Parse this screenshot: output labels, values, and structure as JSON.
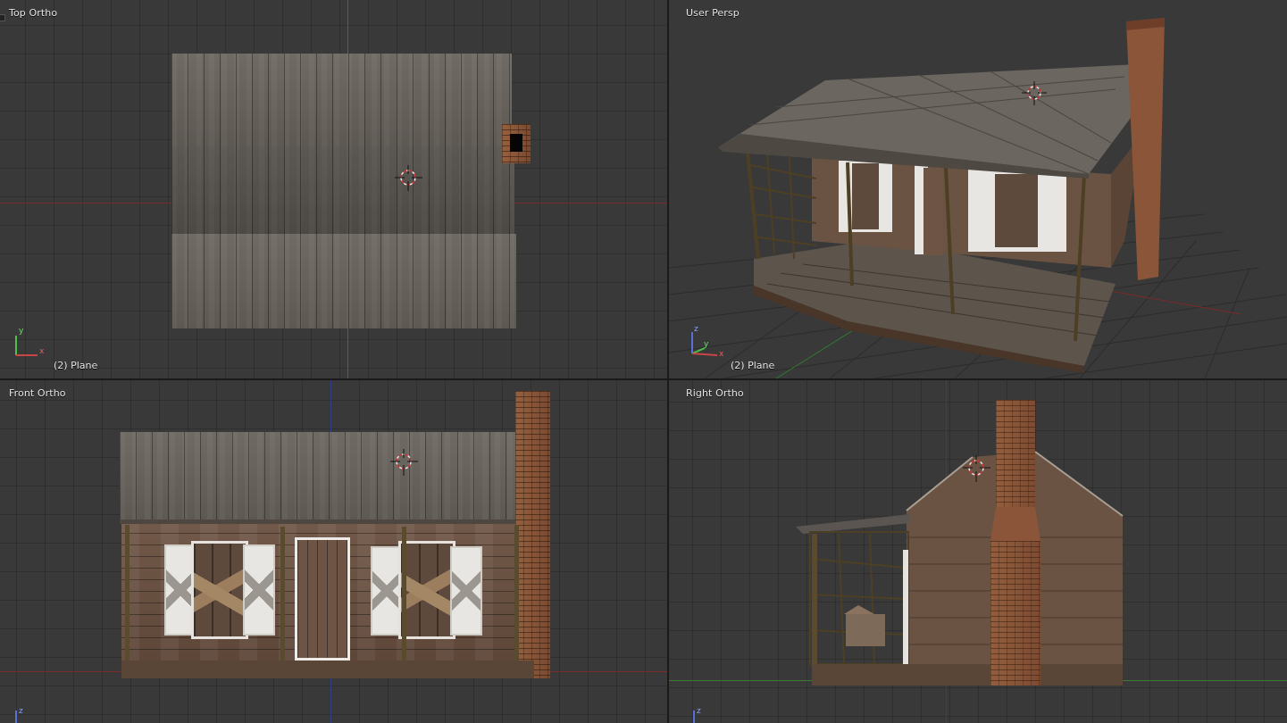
{
  "viewports": {
    "top": {
      "label": "Top Ortho",
      "object": "(2) Plane"
    },
    "persp": {
      "label": "User Persp",
      "object": "(2) Plane"
    },
    "front": {
      "label": "Front Ortho",
      "object": ""
    },
    "right": {
      "label": "Right Ortho",
      "object": ""
    }
  },
  "axis_widget": {
    "top": [
      "y",
      "x"
    ],
    "persp": [
      "z",
      "y",
      "x"
    ],
    "front": [
      "z"
    ],
    "right": [
      "z"
    ]
  },
  "colors": {
    "axis_x": "#7a2a2a",
    "axis_y": "#2f7a2f",
    "axis_z": "#2d3f8a",
    "cursor": "#cc3333",
    "background": "#393939"
  },
  "icons": [
    "3d-cursor-icon",
    "axis-gizmo-icon"
  ]
}
